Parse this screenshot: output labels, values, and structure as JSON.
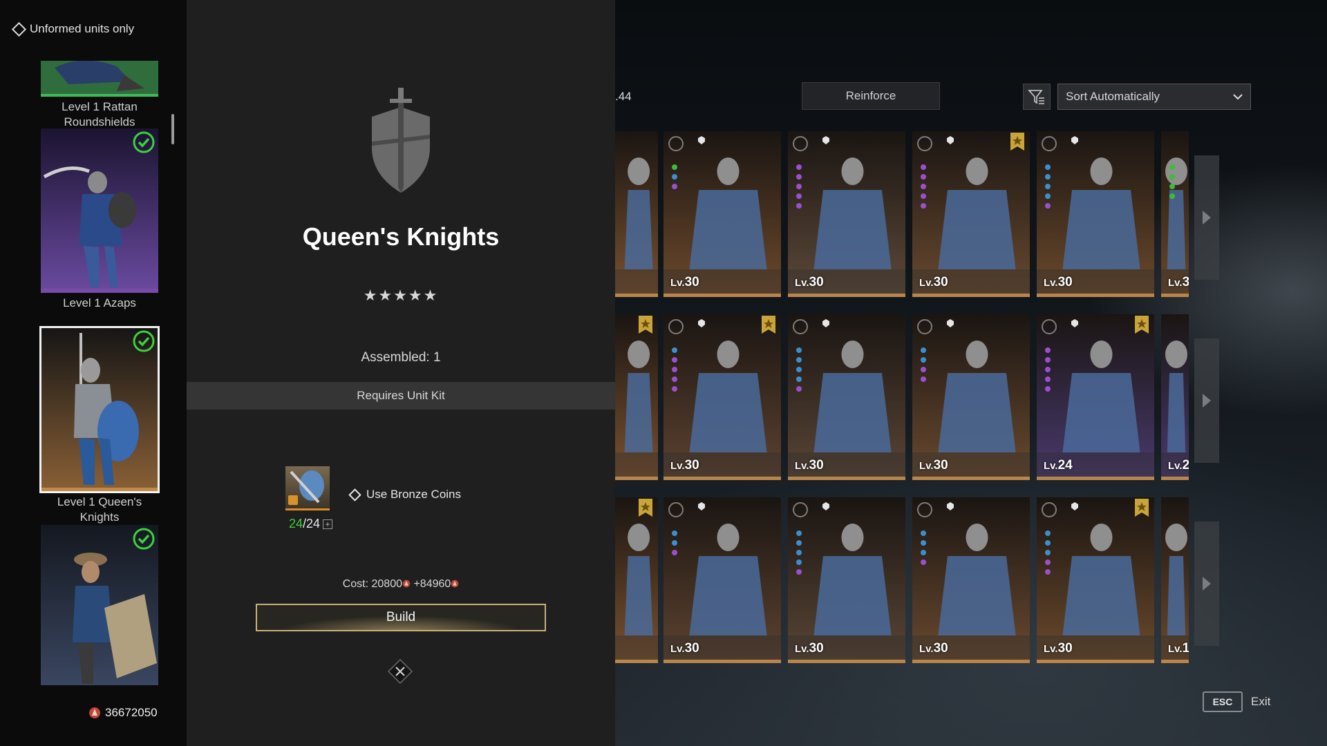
{
  "sidebar": {
    "filter_label": "Unformed units only",
    "items": [
      {
        "label": "Level 1 Rattan Roundshields",
        "checked": false,
        "selected": false,
        "rarity_color": "#2f7a3a"
      },
      {
        "label": "Level 1 Azaps",
        "checked": true,
        "selected": false,
        "rarity_color": "#5a3e8a"
      },
      {
        "label": "Level 1 Queen's Knights",
        "checked": true,
        "selected": true,
        "rarity_color": "#b8864a"
      },
      {
        "label": "",
        "checked": true,
        "selected": false,
        "rarity_color": "#3a4a6a"
      }
    ],
    "currency_value": "36672050"
  },
  "detail": {
    "unit_name": "Queen's Knights",
    "stars": "★★★★★",
    "assembled": "Assembled: 1",
    "requires": "Requires Unit Kit",
    "kit_have": "24",
    "kit_total": "/24",
    "use_coins_label": "Use Bronze Coins",
    "cost_label": "Cost: 20800",
    "cost_extra": " +84960",
    "build_label": "Build"
  },
  "roster": {
    "count_label": ".44",
    "reinforce_label": "Reinforce",
    "sort_label": "Sort Automatically",
    "rows": [
      [
        {
          "level": "",
          "tint": "#7a5230",
          "bookmark": false,
          "dots": []
        },
        {
          "level": "30",
          "tint": "#6e4a2c",
          "bookmark": false,
          "dots": [
            "#3dbb3d",
            "#3a8fd0",
            "#9b4fd0"
          ]
        },
        {
          "level": "30",
          "tint": "#5e4a3a",
          "bookmark": false,
          "dots": [
            "#9b4fd0",
            "#9b4fd0",
            "#9b4fd0",
            "#9b4fd0",
            "#9b4fd0"
          ]
        },
        {
          "level": "30",
          "tint": "#6a4a30",
          "bookmark": true,
          "dots": [
            "#9b4fd0",
            "#9b4fd0",
            "#9b4fd0",
            "#9b4fd0",
            "#9b4fd0"
          ]
        },
        {
          "level": "30",
          "tint": "#6c4a2c",
          "bookmark": false,
          "dots": [
            "#3a8fd0",
            "#3a8fd0",
            "#3a8fd0",
            "#3a8fd0",
            "#9b4fd0"
          ]
        },
        {
          "level": "3",
          "tint": "#6c4a2c",
          "bookmark": false,
          "dots": [
            "#3dbb3d",
            "#3dbb3d",
            "#3dbb3d",
            "#3dbb3d"
          ]
        }
      ],
      [
        {
          "level": "",
          "tint": "#7a5230",
          "bookmark": true,
          "dots": []
        },
        {
          "level": "30",
          "tint": "#5e4330",
          "bookmark": true,
          "dots": [
            "#3a8fd0",
            "#9b4fd0",
            "#9b4fd0",
            "#9b4fd0",
            "#9b4fd0"
          ]
        },
        {
          "level": "30",
          "tint": "#5a4636",
          "bookmark": false,
          "dots": [
            "#3a8fd0",
            "#3a8fd0",
            "#3a8fd0",
            "#3a8fd0",
            "#9b4fd0"
          ]
        },
        {
          "level": "30",
          "tint": "#6a4a30",
          "bookmark": false,
          "dots": [
            "#3a8fd0",
            "#3a8fd0",
            "#9b4fd0",
            "#9b4fd0"
          ]
        },
        {
          "level": "24",
          "tint": "#4a3a6e",
          "bookmark": true,
          "dots": [
            "#9b4fd0",
            "#9b4fd0",
            "#9b4fd0",
            "#9b4fd0",
            "#9b4fd0"
          ]
        },
        {
          "level": "2",
          "tint": "#4a3a6e",
          "bookmark": false,
          "dots": []
        }
      ],
      [
        {
          "level": "",
          "tint": "#7a5230",
          "bookmark": true,
          "dots": []
        },
        {
          "level": "30",
          "tint": "#5e4330",
          "bookmark": false,
          "dots": [
            "#3a8fd0",
            "#3a8fd0",
            "#9b4fd0"
          ]
        },
        {
          "level": "30",
          "tint": "#5a4636",
          "bookmark": false,
          "dots": [
            "#3a8fd0",
            "#3a8fd0",
            "#3a8fd0",
            "#3a8fd0",
            "#9b4fd0"
          ]
        },
        {
          "level": "30",
          "tint": "#6a4a30",
          "bookmark": false,
          "dots": [
            "#3a8fd0",
            "#3a8fd0",
            "#3a8fd0",
            "#9b4fd0"
          ]
        },
        {
          "level": "30",
          "tint": "#6c4a2c",
          "bookmark": true,
          "dots": [
            "#3a8fd0",
            "#3a8fd0",
            "#3a8fd0",
            "#9b4fd0",
            "#9b4fd0"
          ]
        },
        {
          "level": "1",
          "tint": "#6c4a2c",
          "bookmark": false,
          "dots": []
        }
      ]
    ],
    "lv_prefix": "Lv.",
    "esc_key": "ESC",
    "esc_label": "Exit"
  }
}
